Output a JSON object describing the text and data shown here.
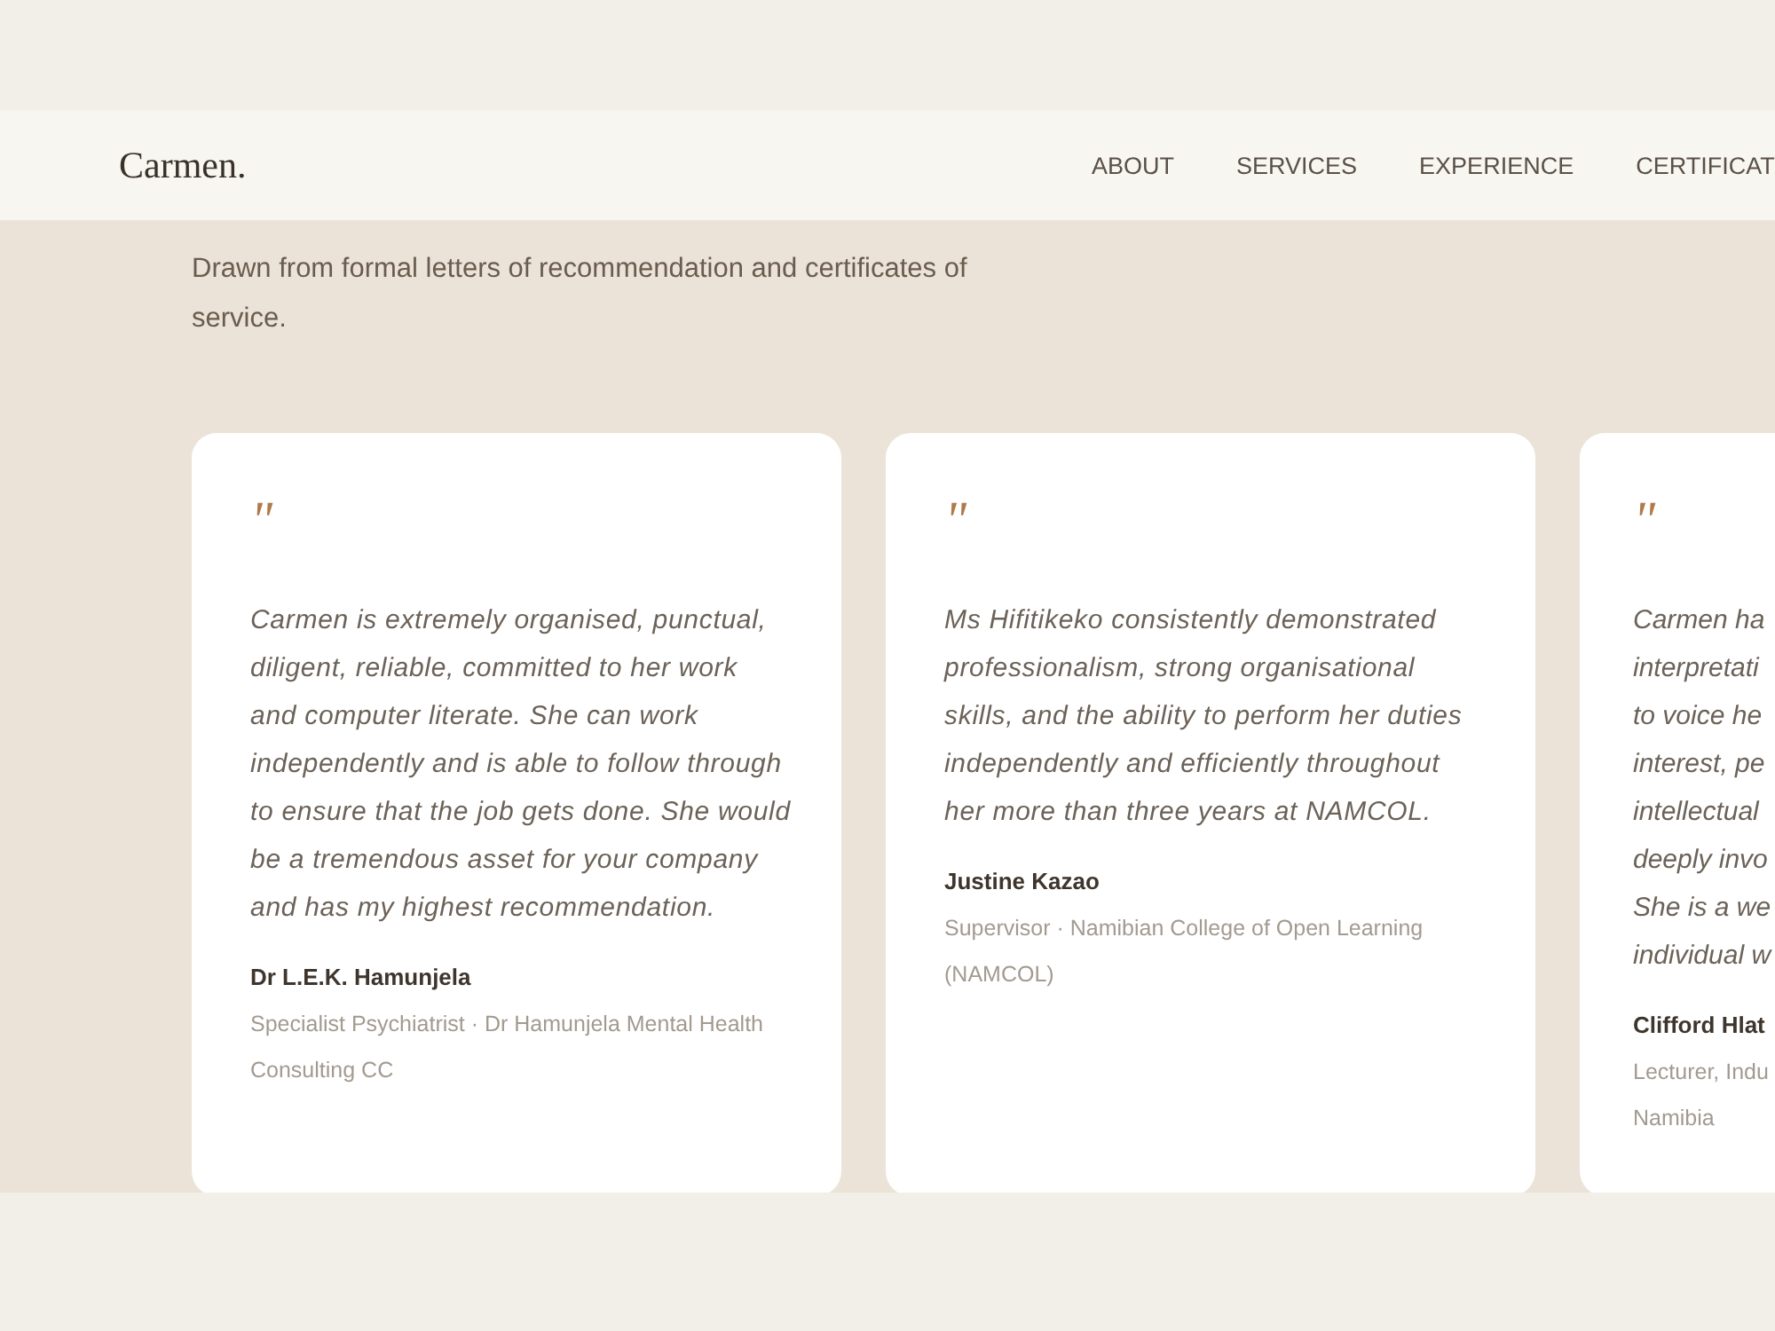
{
  "nav": {
    "logo": "Carmen.",
    "links": [
      {
        "label": "ABOUT"
      },
      {
        "label": "SERVICES"
      },
      {
        "label": "EXPERIENCE"
      },
      {
        "label": "CERTIFICAT"
      }
    ]
  },
  "intro": "Drawn from formal letters of recommendation and certificates of service.",
  "testimonials": [
    {
      "mark": "\"",
      "quote": "Carmen is extremely organised, punctual, diligent, reliable, committed to her work and computer literate. She can work independently and is able to follow through to ensure that the job gets done. She would be a tremendous asset for your company and has my highest recommendation.",
      "author": "Dr L.E.K. Hamunjela",
      "role": "Specialist Psychiatrist · Dr Hamunjela Mental Health Consulting CC"
    },
    {
      "mark": "\"",
      "quote": "Ms Hifitikeko consistently demonstrated professionalism, strong organisational skills, and the ability to perform her duties independently and efficiently throughout her more than three years at NAMCOL.",
      "author": "Justine Kazao",
      "role": "Supervisor · Namibian College of Open Learning (NAMCOL)"
    },
    {
      "mark": "\"",
      "quote": "Carmen ha\ninterpretati\nto voice he\ninterest, pe\nintellectual\ndeeply invo\nShe is a we\nindividual w",
      "author": "Clifford Hlat",
      "role": "Lecturer, Indu\nNamibia"
    }
  ]
}
